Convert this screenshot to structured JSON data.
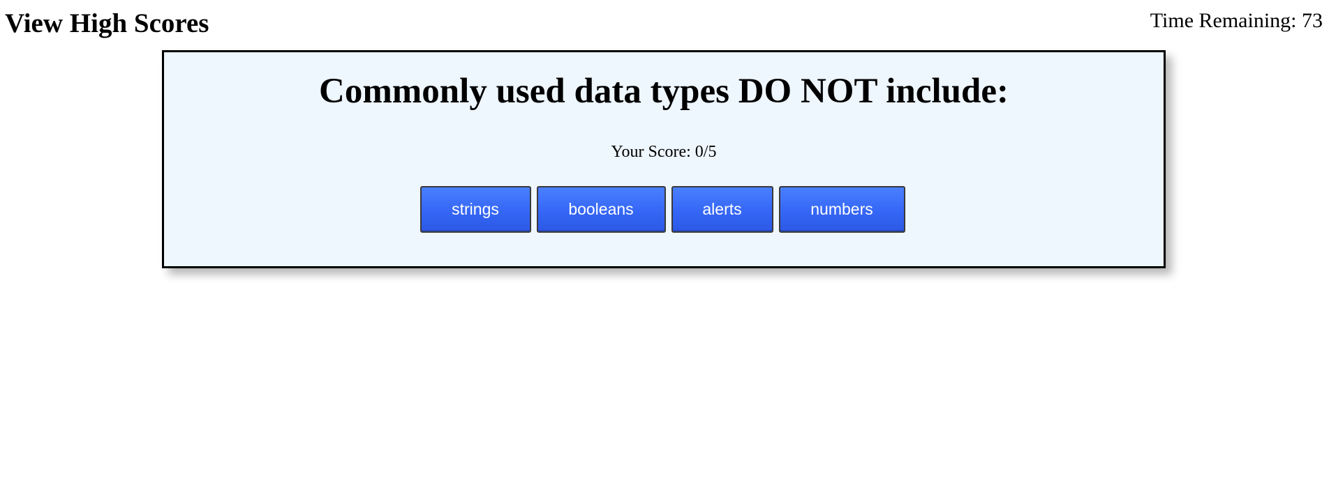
{
  "header": {
    "high_scores_label": "View High Scores",
    "timer_label": "Time Remaining: ",
    "timer_value": "73"
  },
  "quiz": {
    "question": "Commonly used data types DO NOT include:",
    "score_label": "Your Score: ",
    "score_value": "0/5",
    "answers": [
      {
        "label": "strings"
      },
      {
        "label": "booleans"
      },
      {
        "label": "alerts"
      },
      {
        "label": "numbers"
      }
    ]
  },
  "colors": {
    "card_background": "#eef6fe",
    "button_blue": "#3566f5",
    "button_text": "#ffffff"
  }
}
